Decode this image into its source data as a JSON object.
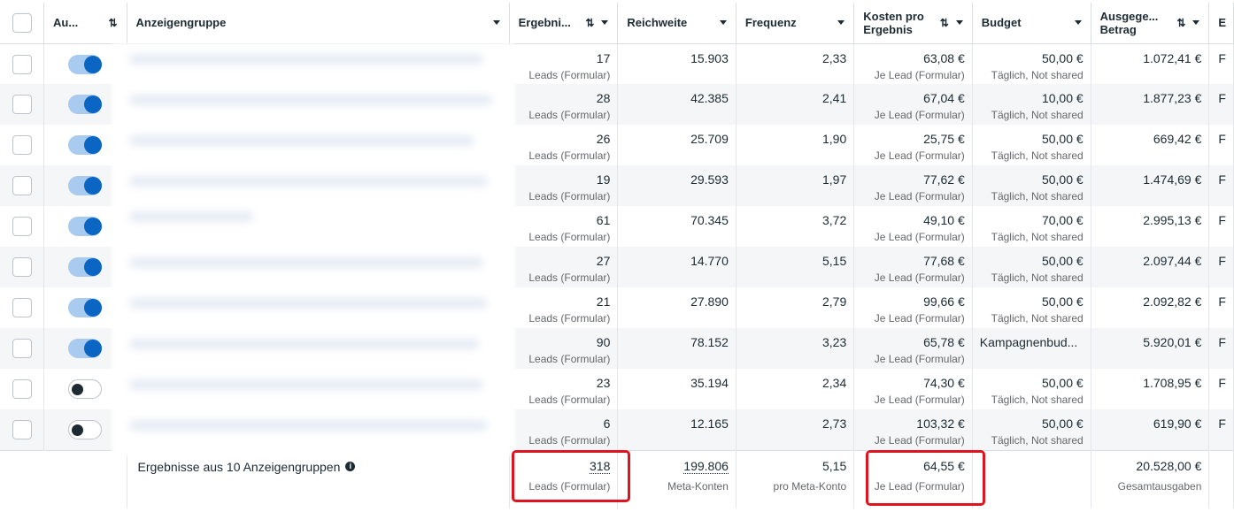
{
  "header": {
    "status": "Au...",
    "name": "Anzeigengruppe",
    "results": "Ergebni...",
    "reach": "Reichweite",
    "frequency": "Frequenz",
    "cost_per_result": "Kosten pro Ergebnis",
    "budget": "Budget",
    "spent": "Ausgege... Betrag",
    "extra": "E"
  },
  "rows": [
    {
      "on": true,
      "results": "17",
      "results_sub": "Leads (Formular)",
      "reach": "15.903",
      "frequency": "2,33",
      "cost": "63,08 €",
      "cost_sub": "Je Lead (Formular)",
      "budget": "50,00 €",
      "budget_sub": "Täglich, Not shared",
      "spent": "1.072,41 €",
      "extra": "F"
    },
    {
      "on": true,
      "results": "28",
      "results_sub": "Leads (Formular)",
      "reach": "42.385",
      "frequency": "2,41",
      "cost": "67,04 €",
      "cost_sub": "Je Lead (Formular)",
      "budget": "10,00 €",
      "budget_sub": "Täglich, Not shared",
      "spent": "1.877,23 €",
      "extra": "F"
    },
    {
      "on": true,
      "results": "26",
      "results_sub": "Leads (Formular)",
      "reach": "25.709",
      "frequency": "1,90",
      "cost": "25,75 €",
      "cost_sub": "Je Lead (Formular)",
      "budget": "50,00 €",
      "budget_sub": "Täglich, Not shared",
      "spent": "669,42 €",
      "extra": "F"
    },
    {
      "on": true,
      "results": "19",
      "results_sub": "Leads (Formular)",
      "reach": "29.593",
      "frequency": "1,97",
      "cost": "77,62 €",
      "cost_sub": "Je Lead (Formular)",
      "budget": "50,00 €",
      "budget_sub": "Täglich, Not shared",
      "spent": "1.474,69 €",
      "extra": "F"
    },
    {
      "on": true,
      "results": "61",
      "results_sub": "Leads (Formular)",
      "reach": "70.345",
      "frequency": "3,72",
      "cost": "49,10 €",
      "cost_sub": "Je Lead (Formular)",
      "budget": "70,00 €",
      "budget_sub": "Täglich, Not shared",
      "spent": "2.995,13 €",
      "extra": "F"
    },
    {
      "on": true,
      "results": "27",
      "results_sub": "Leads (Formular)",
      "reach": "14.770",
      "frequency": "5,15",
      "cost": "77,68 €",
      "cost_sub": "Je Lead (Formular)",
      "budget": "50,00 €",
      "budget_sub": "Täglich, Not shared",
      "spent": "2.097,44 €",
      "extra": "F"
    },
    {
      "on": true,
      "results": "21",
      "results_sub": "Leads (Formular)",
      "reach": "27.890",
      "frequency": "2,79",
      "cost": "99,66 €",
      "cost_sub": "Je Lead (Formular)",
      "budget": "50,00 €",
      "budget_sub": "Täglich, Not shared",
      "spent": "2.092,82 €",
      "extra": "F"
    },
    {
      "on": true,
      "results": "90",
      "results_sub": "Leads (Formular)",
      "reach": "78.152",
      "frequency": "3,23",
      "cost": "65,78 €",
      "cost_sub": "Je Lead (Formular)",
      "budget": "Kampagnenbud...",
      "budget_sub": "",
      "spent": "5.920,01 €",
      "extra": "F"
    },
    {
      "on": false,
      "results": "23",
      "results_sub": "Leads (Formular)",
      "reach": "35.194",
      "frequency": "2,34",
      "cost": "74,30 €",
      "cost_sub": "Je Lead (Formular)",
      "budget": "50,00 €",
      "budget_sub": "Täglich, Not shared",
      "spent": "1.708,95 €",
      "extra": "F"
    },
    {
      "on": false,
      "results": "6",
      "results_sub": "Leads (Formular)",
      "reach": "12.165",
      "frequency": "2,73",
      "cost": "103,32 €",
      "cost_sub": "Je Lead (Formular)",
      "budget": "50,00 €",
      "budget_sub": "Täglich, Not shared",
      "spent": "619,90 €",
      "extra": "F"
    }
  ],
  "total": {
    "label": "Ergebnisse aus 10 Anzeigengruppen",
    "results": "318",
    "results_sub": "Leads (Formular)",
    "reach": "199.806",
    "reach_sub": "Meta-Konten",
    "frequency": "5,15",
    "frequency_sub": "pro Meta-Konto",
    "cost": "64,55 €",
    "cost_sub": "Je Lead (Formular)",
    "spent": "20.528,00 €",
    "spent_sub": "Gesamtausgaben"
  },
  "colors": {
    "highlight": "#e0141e",
    "toggle_on": "#0a66c2",
    "row_alt": "#f5f6f7"
  }
}
